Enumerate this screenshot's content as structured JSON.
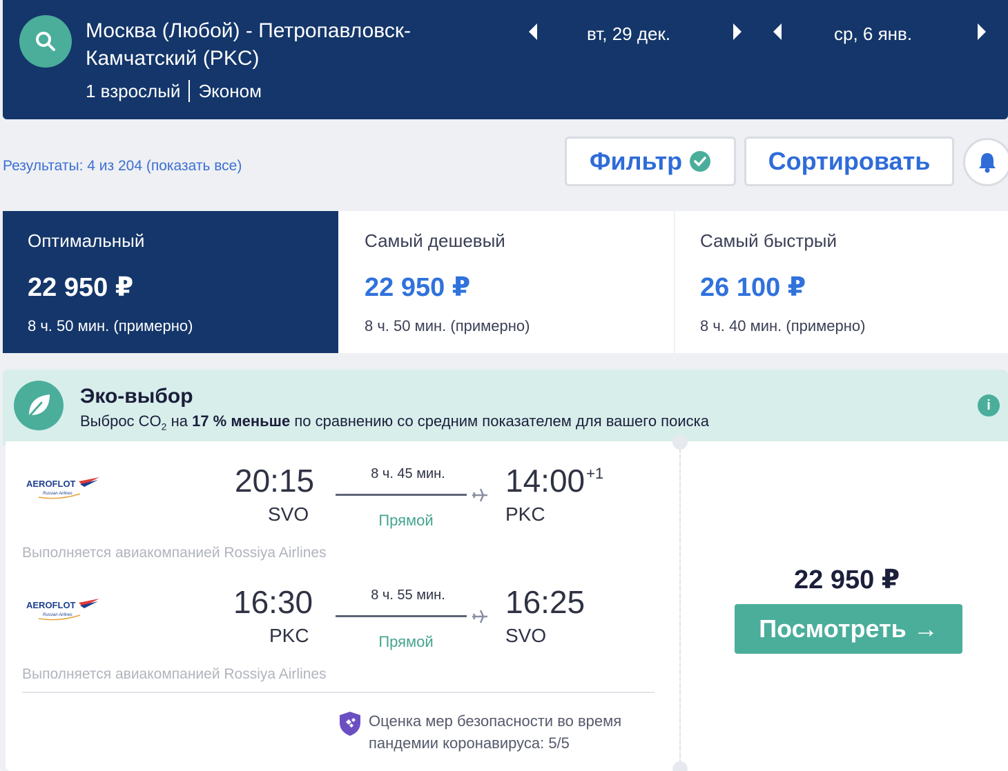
{
  "header": {
    "route": "Москва (Любой) - Петропавловск-Камчатский (PKC)",
    "passengers": "1 взрослый",
    "cabin": "Эконом",
    "depart_date": "вт, 29 дек.",
    "return_date": "ср, 6 янв."
  },
  "toolbar": {
    "results_text": "Результаты: 4 из 204 (показать все)",
    "filter_label": "Фильтр",
    "sort_label": "Сортировать"
  },
  "tabs": [
    {
      "label": "Оптимальный",
      "price": "22 950 ₽",
      "duration": "8 ч. 50 мин. (примерно)"
    },
    {
      "label": "Самый дешевый",
      "price": "22 950 ₽",
      "duration": "8 ч. 50 мин. (примерно)"
    },
    {
      "label": "Самый быстрый",
      "price": "26 100 ₽",
      "duration": "8 ч. 40 мин. (примерно)"
    }
  ],
  "eco": {
    "title": "Эко-выбор",
    "text_prefix": "Выброс CO",
    "text_sub": "2",
    "text_mid": " на ",
    "text_bold": "17 % меньше",
    "text_suffix": " по сравнению со средним показателем для вашего поиска",
    "info_glyph": "i"
  },
  "flights": [
    {
      "airline": "AEROFLOT",
      "airline_sub": "Russian Airlines",
      "dep_time": "20:15",
      "dep_code": "SVO",
      "duration": "8 ч. 45 мин.",
      "stops": "Прямой",
      "arr_time": "14:00",
      "arr_offset": "+1",
      "arr_code": "PKC",
      "operated_by": "Выполняется авиакомпанией Rossiya Airlines"
    },
    {
      "airline": "AEROFLOT",
      "airline_sub": "Russian Airlines",
      "dep_time": "16:30",
      "dep_code": "PKC",
      "duration": "8 ч. 55 мин.",
      "stops": "Прямой",
      "arr_time": "16:25",
      "arr_offset": "",
      "arr_code": "SVO",
      "operated_by": "Выполняется авиакомпанией Rossiya Airlines"
    }
  ],
  "safety": {
    "line1": "Оценка мер безопасности во время",
    "line2": "пандемии коронавируса: 5/5"
  },
  "offer": {
    "price": "22 950 ₽",
    "button_label": "Посмотреть →"
  },
  "colors": {
    "header_bg": "#14366a",
    "accent_teal": "#4aae9b",
    "link_blue": "#3072dc",
    "eco_bg": "#d8eeeb",
    "shield_purple": "#6b4fc2"
  }
}
